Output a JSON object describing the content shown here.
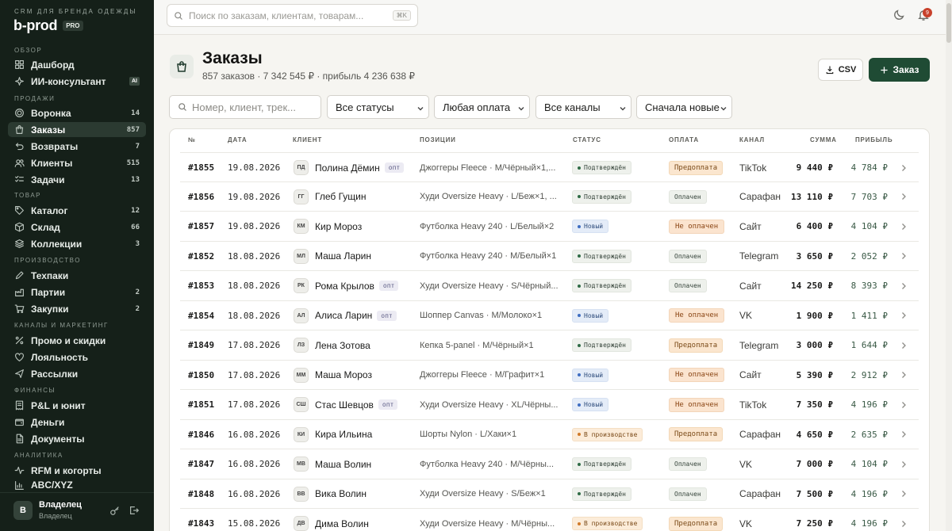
{
  "brand": {
    "subtitle": "CRM ДЛЯ БРЕНДА ОДЕЖДЫ",
    "name": "b-prod",
    "badge": "PRO"
  },
  "sidebar": {
    "sections": [
      {
        "title": "ОБЗОР",
        "items": [
          {
            "label": "Дашборд",
            "icon": "dashboard-icon",
            "count": ""
          },
          {
            "label": "ИИ-консультант",
            "icon": "sparkle-icon",
            "count": "",
            "tag": "AI"
          }
        ]
      },
      {
        "title": "ПРОДАЖИ",
        "items": [
          {
            "label": "Воронка",
            "icon": "target-icon",
            "count": "14"
          },
          {
            "label": "Заказы",
            "icon": "bag-icon",
            "count": "857",
            "active": true
          },
          {
            "label": "Возвраты",
            "icon": "return-icon",
            "count": "7"
          },
          {
            "label": "Клиенты",
            "icon": "users-icon",
            "count": "515"
          },
          {
            "label": "Задачи",
            "icon": "checklist-icon",
            "count": "13"
          }
        ]
      },
      {
        "title": "ТОВАР",
        "items": [
          {
            "label": "Каталог",
            "icon": "tag-icon",
            "count": "12"
          },
          {
            "label": "Склад",
            "icon": "box-icon",
            "count": "66"
          },
          {
            "label": "Коллекции",
            "icon": "layers-icon",
            "count": "3"
          }
        ]
      },
      {
        "title": "ПРОИЗВОДСТВО",
        "items": [
          {
            "label": "Техпаки",
            "icon": "pencil-icon",
            "count": ""
          },
          {
            "label": "Партии",
            "icon": "factory-icon",
            "count": "2"
          },
          {
            "label": "Закупки",
            "icon": "cart-icon",
            "count": "2"
          }
        ]
      },
      {
        "title": "КАНАЛЫ И МАРКЕТИНГ",
        "items": [
          {
            "label": "Промо и скидки",
            "icon": "percent-icon",
            "count": ""
          },
          {
            "label": "Лояльность",
            "icon": "heart-icon",
            "count": ""
          },
          {
            "label": "Рассылки",
            "icon": "send-icon",
            "count": ""
          }
        ]
      },
      {
        "title": "ФИНАНСЫ",
        "items": [
          {
            "label": "P&L и юнит",
            "icon": "receipt-icon",
            "count": ""
          },
          {
            "label": "Деньги",
            "icon": "wallet-icon",
            "count": ""
          },
          {
            "label": "Документы",
            "icon": "document-icon",
            "count": ""
          }
        ]
      },
      {
        "title": "АНАЛИТИКА",
        "items": [
          {
            "label": "RFM и когорты",
            "icon": "pulse-icon",
            "count": ""
          },
          {
            "label": "ABC/XYZ",
            "icon": "chart-icon",
            "count": ""
          }
        ]
      }
    ],
    "user": {
      "initial": "В",
      "name": "Владелец",
      "role": "Владелец"
    }
  },
  "topbar": {
    "search_placeholder": "Поиск по заказам, клиентам, товарам...",
    "shortcut": "⌘K",
    "notifications": "9"
  },
  "page": {
    "title": "Заказы",
    "subtitle": "857 заказов · 7 342 545 ₽ · прибыль 4 236 638 ₽",
    "csv_label": "CSV",
    "add_label": "Заказ"
  },
  "filters": {
    "search_placeholder": "Номер, клиент, трек...",
    "status": "Все статусы",
    "payment": "Любая оплата",
    "channel": "Все каналы",
    "sort": "Сначала новые"
  },
  "table": {
    "columns": [
      "№",
      "ДАТА",
      "КЛИЕНТ",
      "ПОЗИЦИИ",
      "СТАТУС",
      "ОПЛАТА",
      "КАНАЛ",
      "СУММА",
      "ПРИБЫЛЬ"
    ],
    "rows": [
      {
        "num": "#1855",
        "date": "19.08.2026",
        "ini": "ПД",
        "client": "Полина Дёмин",
        "opt": true,
        "items": "Джоггеры Fleece · M/Чёрный×1,...",
        "status": "Подтверждён",
        "st": "ok",
        "pay": "Предоплата",
        "pt": "pre",
        "channel": "TikTok",
        "sum": "9 440 ₽",
        "profit": "4 784 ₽"
      },
      {
        "num": "#1856",
        "date": "19.08.2026",
        "ini": "ГГ",
        "client": "Глеб Гущин",
        "opt": false,
        "items": "Худи Oversize Heavy · L/Беж×1, ...",
        "status": "Подтверждён",
        "st": "ok",
        "pay": "Оплачен",
        "pt": "ok",
        "channel": "Сарафан",
        "sum": "13 110 ₽",
        "profit": "7 703 ₽"
      },
      {
        "num": "#1857",
        "date": "19.08.2026",
        "ini": "КМ",
        "client": "Кир Мороз",
        "opt": false,
        "items": "Футболка Heavy 240 · L/Белый×2",
        "status": "Новый",
        "st": "new",
        "pay": "Не оплачен",
        "pt": "no",
        "channel": "Сайт",
        "sum": "6 400 ₽",
        "profit": "4 104 ₽"
      },
      {
        "num": "#1852",
        "date": "18.08.2026",
        "ini": "МЛ",
        "client": "Маша Ларин",
        "opt": false,
        "items": "Футболка Heavy 240 · M/Белый×1",
        "status": "Подтверждён",
        "st": "ok",
        "pay": "Оплачен",
        "pt": "ok",
        "channel": "Telegram",
        "sum": "3 650 ₽",
        "profit": "2 052 ₽"
      },
      {
        "num": "#1853",
        "date": "18.08.2026",
        "ini": "РК",
        "client": "Рома Крылов",
        "opt": true,
        "items": "Худи Oversize Heavy · S/Чёрный...",
        "status": "Подтверждён",
        "st": "ok",
        "pay": "Оплачен",
        "pt": "ok",
        "channel": "Сайт",
        "sum": "14 250 ₽",
        "profit": "8 393 ₽"
      },
      {
        "num": "#1854",
        "date": "18.08.2026",
        "ini": "АЛ",
        "client": "Алиса Ларин",
        "opt": true,
        "items": "Шоппер Canvas · M/Молоко×1",
        "status": "Новый",
        "st": "new",
        "pay": "Не оплачен",
        "pt": "no",
        "channel": "VK",
        "sum": "1 900 ₽",
        "profit": "1 411 ₽"
      },
      {
        "num": "#1849",
        "date": "17.08.2026",
        "ini": "ЛЗ",
        "client": "Лена Зотова",
        "opt": false,
        "items": "Кепка 5-panel · M/Чёрный×1",
        "status": "Подтверждён",
        "st": "ok",
        "pay": "Предоплата",
        "pt": "pre",
        "channel": "Telegram",
        "sum": "3 000 ₽",
        "profit": "1 644 ₽"
      },
      {
        "num": "#1850",
        "date": "17.08.2026",
        "ini": "ММ",
        "client": "Маша Мороз",
        "opt": false,
        "items": "Джоггеры Fleece · M/Графит×1",
        "status": "Новый",
        "st": "new",
        "pay": "Не оплачен",
        "pt": "no",
        "channel": "Сайт",
        "sum": "5 390 ₽",
        "profit": "2 912 ₽"
      },
      {
        "num": "#1851",
        "date": "17.08.2026",
        "ini": "СШ",
        "client": "Стас Шевцов",
        "opt": true,
        "items": "Худи Oversize Heavy · XL/Чёрны...",
        "status": "Новый",
        "st": "new",
        "pay": "Не оплачен",
        "pt": "no",
        "channel": "TikTok",
        "sum": "7 350 ₽",
        "profit": "4 196 ₽"
      },
      {
        "num": "#1846",
        "date": "16.08.2026",
        "ini": "КИ",
        "client": "Кира Ильина",
        "opt": false,
        "items": "Шорты Nylon · L/Хаки×1",
        "status": "В производстве",
        "st": "prod",
        "pay": "Предоплата",
        "pt": "pre",
        "channel": "Сарафан",
        "sum": "4 650 ₽",
        "profit": "2 635 ₽"
      },
      {
        "num": "#1847",
        "date": "16.08.2026",
        "ini": "МВ",
        "client": "Маша Волин",
        "opt": false,
        "items": "Футболка Heavy 240 · M/Чёрны...",
        "status": "Подтверждён",
        "st": "ok",
        "pay": "Оплачен",
        "pt": "ok",
        "channel": "VK",
        "sum": "7 000 ₽",
        "profit": "4 104 ₽"
      },
      {
        "num": "#1848",
        "date": "16.08.2026",
        "ini": "ВВ",
        "client": "Вика Волин",
        "opt": false,
        "items": "Худи Oversize Heavy · S/Беж×1",
        "status": "Подтверждён",
        "st": "ok",
        "pay": "Оплачен",
        "pt": "ok",
        "channel": "Сарафан",
        "sum": "7 500 ₽",
        "profit": "4 196 ₽"
      },
      {
        "num": "#1843",
        "date": "15.08.2026",
        "ini": "ДВ",
        "client": "Дима Волин",
        "opt": false,
        "items": "Худи Oversize Heavy · M/Чёрны...",
        "status": "В производстве",
        "st": "prod",
        "pay": "Предоплата",
        "pt": "pre",
        "channel": "VK",
        "sum": "7 250 ₽",
        "profit": "4 196 ₽"
      }
    ],
    "opt_label": "опт"
  }
}
